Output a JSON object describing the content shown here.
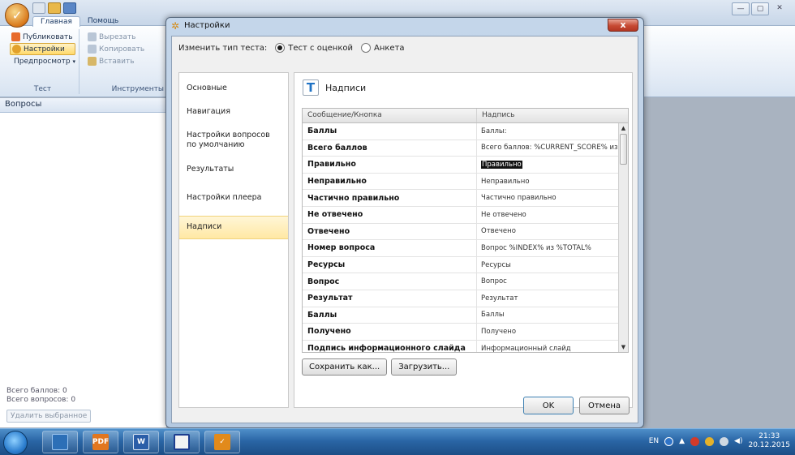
{
  "app": {
    "ribbon_tabs": [
      "Главная",
      "Помощь"
    ],
    "groups": {
      "test": {
        "label": "Тест",
        "items": [
          "Публиковать",
          "Настройки",
          "Предпросмотр"
        ]
      },
      "tools": {
        "label": "Инструменты",
        "items": [
          "Вырезать",
          "Копировать",
          "Вставить"
        ]
      }
    },
    "left_panel": {
      "header": "Вопросы",
      "total_score": "Всего баллов: 0",
      "total_questions": "Всего вопросов: 0",
      "delete_button": "Удалить выбранное"
    }
  },
  "dialog": {
    "title": "Настройки",
    "close_symbol": "x",
    "type_label": "Изменить тип теста:",
    "type_options": [
      "Тест с оценкой",
      "Анкета"
    ],
    "type_selected": 0,
    "nav_items": [
      "Основные",
      "Навигация",
      "Настройки вопросов по умолчанию",
      "Результаты",
      "Настройки плеера",
      "Надписи"
    ],
    "nav_active": 5,
    "section_title": "Надписи",
    "grid": {
      "columns": [
        "Сообщение/Кнопка",
        "Надпись"
      ],
      "rows": [
        [
          "Баллы",
          "Баллы:"
        ],
        [
          "Всего баллов",
          "Всего баллов: %CURRENT_SCORE% из"
        ],
        [
          "Правильно",
          "Правильно"
        ],
        [
          "Неправильно",
          "Неправильно"
        ],
        [
          "Частично правильно",
          "Частично правильно"
        ],
        [
          "Не отвечено",
          "Не отвечено"
        ],
        [
          "Отвечено",
          "Отвечено"
        ],
        [
          "Номер вопроса",
          "Вопрос %INDEX% из %TOTAL%"
        ],
        [
          "Ресурсы",
          "Ресурсы"
        ],
        [
          "Вопрос",
          "Вопрос"
        ],
        [
          "Результат",
          "Результат"
        ],
        [
          "Баллы",
          "Баллы"
        ],
        [
          "Получено",
          "Получено"
        ],
        [
          "Подпись информационного слайда",
          "Информационный слайд"
        ]
      ],
      "selected_row": 2
    },
    "save_button": "Сохранить как...",
    "load_button": "Загрузить...",
    "ok_button": "OK",
    "cancel_button": "Отмена"
  },
  "taskbar": {
    "lang": "EN",
    "time": "21:33",
    "date": "20.12.2015"
  }
}
